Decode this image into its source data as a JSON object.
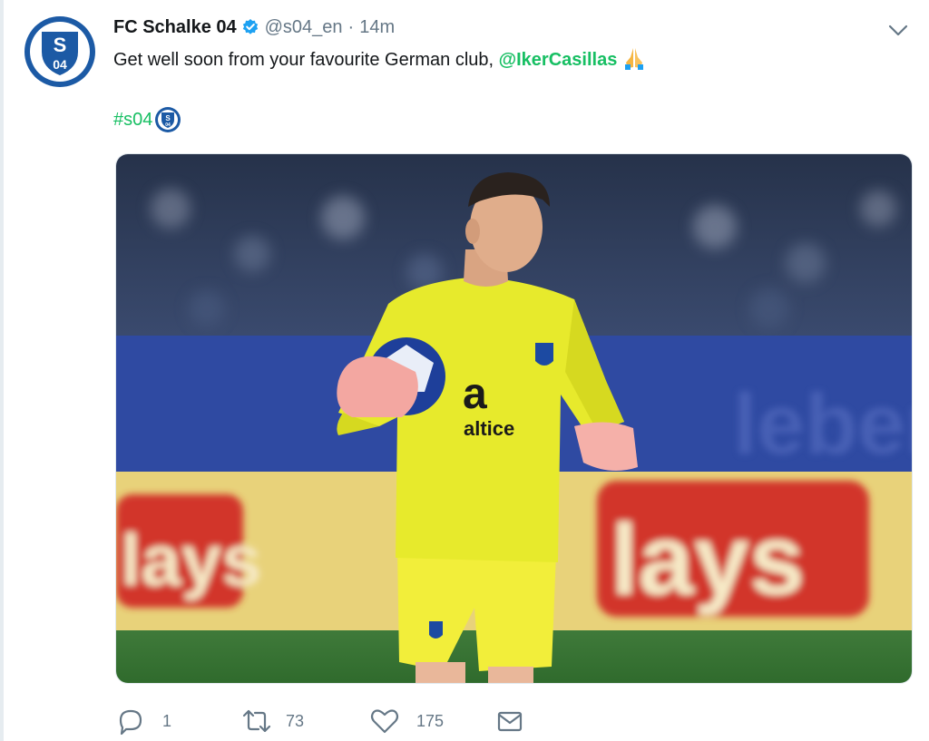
{
  "tweet": {
    "author_name": "FC Schalke 04",
    "author_handle": "@s04_en",
    "separator": "·",
    "time_ago": "14m",
    "text_prefix": "Get well soon from your favourite German club, ",
    "mention": "@IkerCasillas",
    "hashtag": "#s04",
    "emoji_text": "pray-emoji",
    "hashtag_emoji": "s04-crest-emoji"
  },
  "media_image": {
    "jersey_text": "altice",
    "board_text_1": "lays",
    "board_text_2": "lays"
  },
  "actions": {
    "reply_count": "1",
    "retweet_count": "73",
    "like_count": "175"
  },
  "icons": {
    "avatar": "schalke-crest-icon",
    "verified": "verified-badge-icon",
    "menu": "chevron-down-icon",
    "reply": "reply-icon",
    "retweet": "retweet-icon",
    "like": "heart-icon",
    "dm": "envelope-icon"
  },
  "colors": {
    "mention": "#17bf63",
    "hashtag": "#17bf63",
    "muted": "#657786",
    "verified": "#1da1f2",
    "schalke_blue": "#1c5aa5"
  }
}
